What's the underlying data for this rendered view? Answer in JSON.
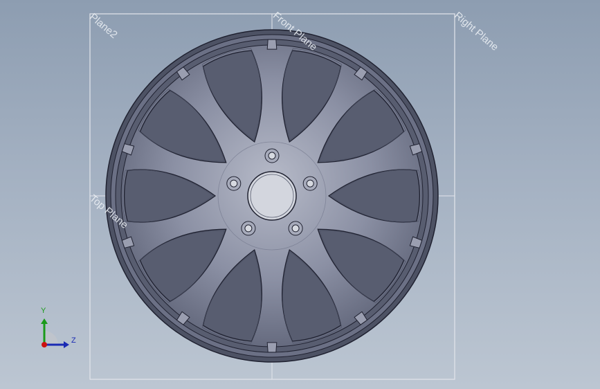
{
  "planes": {
    "plane2": "Plane2",
    "front_plane": "Front Plane",
    "right_plane": "Right Plane",
    "top_plane": "Top Plane"
  },
  "triad": {
    "y_label": "Y",
    "z_label": "Z"
  },
  "model": {
    "type": "wheel-rim",
    "spoke_count": 10,
    "lug_hole_count": 5,
    "colors": {
      "rim": "#4f5466",
      "rim_face": "#767b90",
      "spoke": "#8a8fa2",
      "edge": "#1f2130",
      "plane_outline": "#e3e6ec",
      "axis_y": "#1a9a1a",
      "axis_z": "#1a2ab4",
      "origin": "#cc1111"
    }
  }
}
